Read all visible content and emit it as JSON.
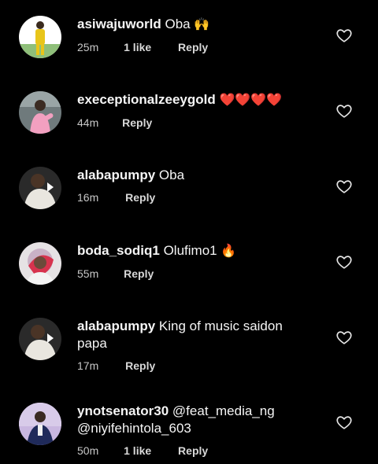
{
  "comments": [
    {
      "username": "asiwajuworld",
      "text": " Oba ",
      "emoji": "🙌",
      "time": "25m",
      "likes": "1 like",
      "reply": "Reply",
      "avatar": "person-yellow-suit"
    },
    {
      "username": "execeptionalzeeygold",
      "text": " ",
      "emoji": "❤️❤️❤️❤️",
      "time": "44m",
      "likes": "",
      "reply": "Reply",
      "avatar": "person-pink-top"
    },
    {
      "username": "alabapumpy",
      "text": " Oba",
      "emoji": "",
      "time": "16m",
      "likes": "",
      "reply": "Reply",
      "avatar": "person-white-agbada"
    },
    {
      "username": "boda_sodiq1",
      "text": " Olufimo1 ",
      "emoji": "🔥",
      "time": "55m",
      "likes": "",
      "reply": "Reply",
      "avatar": "person-sticker"
    },
    {
      "username": "alabapumpy",
      "text": " King of music saidon papa",
      "emoji": "",
      "time": "17m",
      "likes": "",
      "reply": "Reply",
      "avatar": "person-white-agbada"
    },
    {
      "username": "ynotsenator30",
      "text": " @feat_media_ng @niyifehintola_603",
      "emoji": "",
      "time": "50m",
      "likes": "1 like",
      "reply": "Reply",
      "avatar": "person-purple"
    }
  ],
  "icons": {
    "like": "heart-outline-icon"
  },
  "colors": {
    "background": "#000000",
    "text": "#f5f5f5",
    "meta": "#c7c7c7",
    "heart_emoji": "#e0262c"
  }
}
